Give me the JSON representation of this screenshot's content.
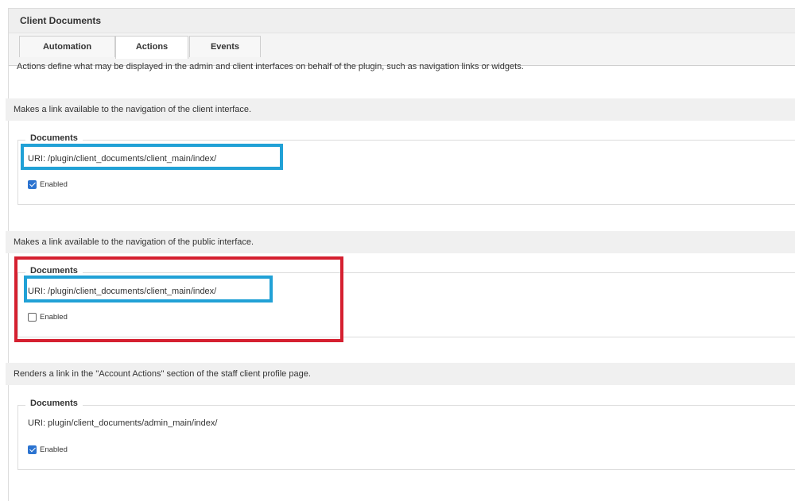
{
  "panel": {
    "title": "Client Documents"
  },
  "tabs": [
    {
      "label": "Automation",
      "active": false
    },
    {
      "label": "Actions",
      "active": true
    },
    {
      "label": "Events",
      "active": false
    }
  ],
  "description": "Actions define what may be displayed in the admin and client interfaces on behalf of the plugin, such as navigation links or widgets.",
  "actions": [
    {
      "heading": "Makes a link available to the navigation of the client interface.",
      "name": "Documents",
      "uri": "URI: /plugin/client_documents/client_main/index/",
      "enabled_label": "Enabled",
      "enabled": true
    },
    {
      "heading": "Makes a link available to the navigation of the public interface.",
      "name": "Documents",
      "uri": "URI: /plugin/client_documents/client_main/index/",
      "enabled_label": "Enabled",
      "enabled": false
    },
    {
      "heading": "Renders a link in the \"Account Actions\" section of the staff client profile page.",
      "name": "Documents",
      "uri": "URI: plugin/client_documents/admin_main/index/",
      "enabled_label": "Enabled",
      "enabled": true
    }
  ],
  "annotation_colors": {
    "blue": "#21a1d6",
    "red": "#d52030"
  },
  "accent": "#2b73d0"
}
